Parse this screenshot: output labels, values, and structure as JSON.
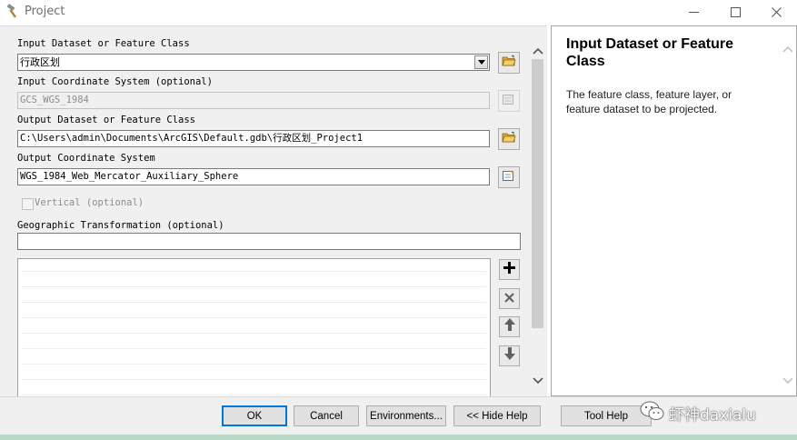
{
  "window": {
    "title": "Project",
    "icon": "hammer-icon",
    "controls": [
      "minimize-icon",
      "maximize-icon",
      "close-icon"
    ]
  },
  "params": {
    "input_dataset": {
      "label": "Input Dataset or Feature Class",
      "value": "行政区划"
    },
    "input_cs": {
      "label": "Input Coordinate System (optional)",
      "value": "GCS_WGS_1984"
    },
    "output_dataset": {
      "label": "Output Dataset or Feature Class",
      "value": "C:\\Users\\admin\\Documents\\ArcGIS\\Default.gdb\\行政区划_Project1"
    },
    "output_cs": {
      "label": "Output Coordinate System",
      "value": "WGS_1984_Web_Mercator_Auxiliary_Sphere"
    },
    "vertical": {
      "label": "Vertical (optional)",
      "checked": false
    },
    "geo_transform": {
      "label": "Geographic Transformation (optional)",
      "value": ""
    }
  },
  "help": {
    "title": "Input Dataset or Feature Class",
    "body": "The feature class, feature layer, or feature dataset to be projected."
  },
  "buttons": {
    "ok": "OK",
    "cancel": "Cancel",
    "environments": "Environments...",
    "hide_help": "<< Hide Help",
    "tool_help": "Tool Help"
  },
  "watermark": {
    "text": "虾神daxialu"
  },
  "colors": {
    "folder": "#f0c040",
    "default_button_border": "#0078d7",
    "panel_bg": "#f0f0f0"
  }
}
